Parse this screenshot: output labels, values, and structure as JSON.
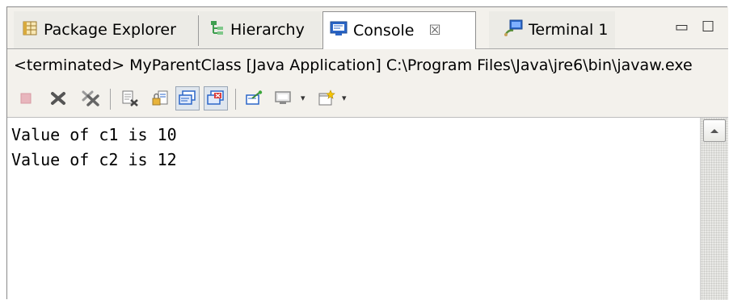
{
  "tabs": [
    {
      "label": "Package Explorer",
      "icon": "package-explorer-icon",
      "active": false
    },
    {
      "label": "Hierarchy",
      "icon": "hierarchy-icon",
      "active": false
    },
    {
      "label": "Console",
      "icon": "console-icon",
      "active": true
    },
    {
      "label": "Terminal 1",
      "icon": "terminal-icon",
      "active": false
    }
  ],
  "close_glyph": "☒",
  "window_controls": {
    "minimize": "▭",
    "maximize": "☐"
  },
  "description": "<terminated> MyParentClass [Java Application] C:\\Program Files\\Java\\jre6\\bin\\javaw.exe",
  "toolbar": {
    "icons": [
      "terminate-icon",
      "remove-launch-icon",
      "remove-all-terminated-icon",
      "clear-console-icon",
      "scroll-lock-icon",
      "show-on-stdout-icon",
      "show-on-stderr-icon",
      "pin-console-icon",
      "display-selected-console-icon",
      "open-console-icon"
    ],
    "dropdown_glyph": "▾"
  },
  "console_lines": [
    "Value of c1 is 10",
    "Value of c2 is 12"
  ],
  "colors": {
    "accent": "#2b66c8",
    "chrome": "#f3f1ec",
    "pressed": "#dfe6ee"
  }
}
